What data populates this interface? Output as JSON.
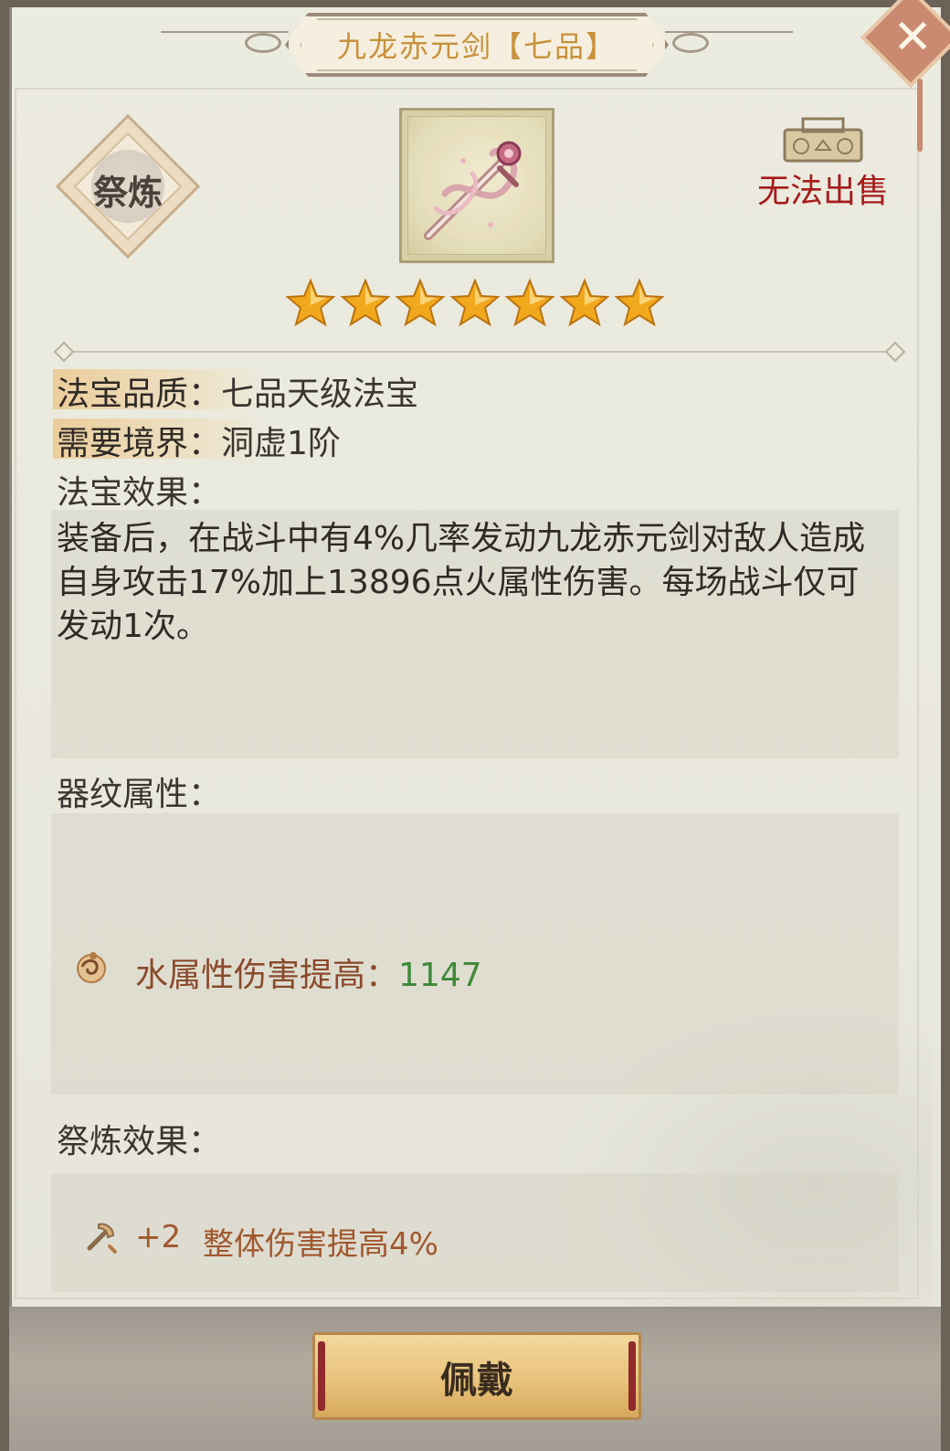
{
  "title": "九龙赤元剑【七品】",
  "close_icon": "close-x-icon",
  "refine_button": "祭炼",
  "item_icon": "red-jade-sword-icon",
  "sell_status": "无法出售",
  "stars": {
    "filled": 7,
    "total": 7
  },
  "info": {
    "quality_label": "法宝品质：",
    "quality_value": "七品天级法宝",
    "realm_label": "需要境界：",
    "realm_value": "洞虚1阶",
    "effect_label": "法宝效果："
  },
  "effect_text": "装备后，在战斗中有4%几率发动九龙赤元剑对敌人造成自身攻击17%加上13896点火属性伤害。每场战斗仅可发动1次。",
  "pattern": {
    "label": "器纹属性：",
    "attr_name": "水属性伤害提高：",
    "attr_value": "1147"
  },
  "refine_effect": {
    "label": "祭炼效果：",
    "level": "+2",
    "desc": "整体伤害提高4%"
  },
  "wear_button": "佩戴",
  "colors": {
    "title": "#c8913c",
    "no_sell": "#a61b1b",
    "attr_name": "#8a4a2c",
    "attr_value": "#3f8a3a",
    "star": "#f2a81c"
  }
}
